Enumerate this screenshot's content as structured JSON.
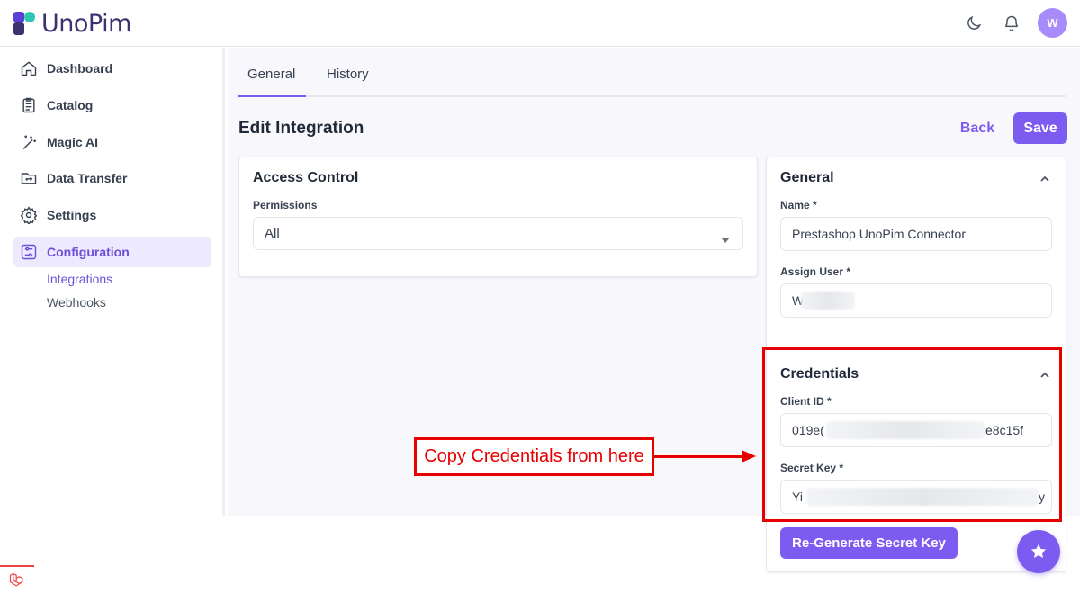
{
  "app": {
    "name": "UnoPim"
  },
  "header": {
    "avatar_initial": "W"
  },
  "sidebar": {
    "items": [
      {
        "label": "Dashboard",
        "icon": "home-icon"
      },
      {
        "label": "Catalog",
        "icon": "clipboard-icon"
      },
      {
        "label": "Magic AI",
        "icon": "magic-wand-icon"
      },
      {
        "label": "Data Transfer",
        "icon": "transfer-icon"
      },
      {
        "label": "Settings",
        "icon": "gear-icon"
      },
      {
        "label": "Configuration",
        "icon": "sliders-icon",
        "active": true
      }
    ],
    "sub_items": [
      {
        "label": "Integrations",
        "active": true
      },
      {
        "label": "Webhooks"
      }
    ]
  },
  "tabs": [
    {
      "label": "General",
      "active": true
    },
    {
      "label": "History"
    }
  ],
  "page": {
    "title": "Edit Integration",
    "back_label": "Back",
    "save_label": "Save"
  },
  "access_control": {
    "title": "Access Control",
    "permissions_label": "Permissions",
    "permissions_value": "All"
  },
  "general": {
    "title": "General",
    "name_label": "Name *",
    "name_value": "Prestashop UnoPim Connector",
    "assign_user_label": "Assign User *",
    "assign_user_value": "W"
  },
  "credentials": {
    "title": "Credentials",
    "client_id_label": "Client ID *",
    "client_id_start": "019e(",
    "client_id_end": "e8c15f",
    "secret_key_label": "Secret Key *",
    "secret_key_start": "Yi",
    "secret_key_end": "y",
    "regenerate_label": "Re-Generate Secret Key"
  },
  "annotation": {
    "callout_text": "Copy Credentials from here"
  },
  "colors": {
    "accent": "#7c5cf0",
    "annotation": "#e60000"
  }
}
